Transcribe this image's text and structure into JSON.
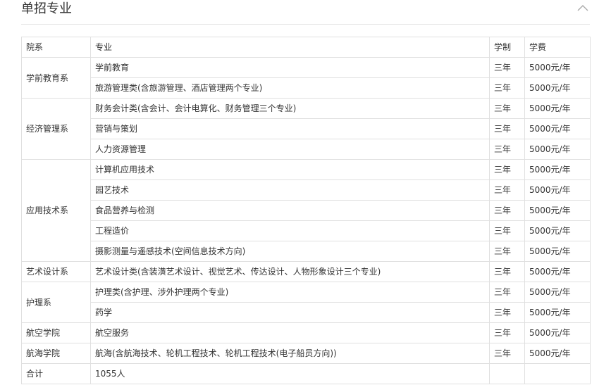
{
  "section": {
    "title": "单招专业",
    "collapse_icon": "chevron-up-icon"
  },
  "table": {
    "headers": [
      "院系",
      "专业",
      "学制",
      "学费"
    ],
    "departments": [
      {
        "name": "学前教育系",
        "majors": [
          {
            "name": "学前教育",
            "duration": "三年",
            "fee": "5000元/年"
          },
          {
            "name": "旅游管理类(含旅游管理、酒店管理两个专业)",
            "duration": "三年",
            "fee": "5000元/年"
          }
        ]
      },
      {
        "name": "经济管理系",
        "majors": [
          {
            "name": "财务会计类(含会计、会计电算化、财务管理三个专业)",
            "duration": "三年",
            "fee": "5000元/年"
          },
          {
            "name": "营销与策划",
            "duration": "三年",
            "fee": "5000元/年"
          },
          {
            "name": "人力资源管理",
            "duration": "三年",
            "fee": "5000元/年"
          }
        ]
      },
      {
        "name": "应用技术系",
        "majors": [
          {
            "name": "计算机应用技术",
            "duration": "三年",
            "fee": "5000元/年"
          },
          {
            "name": "园艺技术",
            "duration": "三年",
            "fee": "5000元/年"
          },
          {
            "name": "食品营养与检测",
            "duration": "三年",
            "fee": "5000元/年"
          },
          {
            "name": "工程造价",
            "duration": "三年",
            "fee": "5000元/年"
          },
          {
            "name": "摄影测量与遥感技术(空间信息技术方向)",
            "duration": "三年",
            "fee": "5000元/年"
          }
        ]
      },
      {
        "name": "艺术设计系",
        "majors": [
          {
            "name": "艺术设计类(含装潢艺术设计、视觉艺术、传达设计、人物形象设计三个专业)",
            "duration": "三年",
            "fee": "5000元/年"
          }
        ]
      },
      {
        "name": "护理系",
        "majors": [
          {
            "name": "护理类(含护理、涉外护理两个专业)",
            "duration": "三年",
            "fee": "5000元/年"
          },
          {
            "name": "药学",
            "duration": "三年",
            "fee": "5000元/年"
          }
        ]
      },
      {
        "name": "航空学院",
        "majors": [
          {
            "name": "航空服务",
            "duration": "三年",
            "fee": "5000元/年"
          }
        ]
      },
      {
        "name": "航海学院",
        "majors": [
          {
            "name": "航海(含航海技术、轮机工程技术、轮机工程技术(电子船员方向))",
            "duration": "三年",
            "fee": "5000元/年"
          }
        ]
      }
    ],
    "total": {
      "label": "合计",
      "value": "1055人",
      "duration": "",
      "fee": ""
    }
  }
}
